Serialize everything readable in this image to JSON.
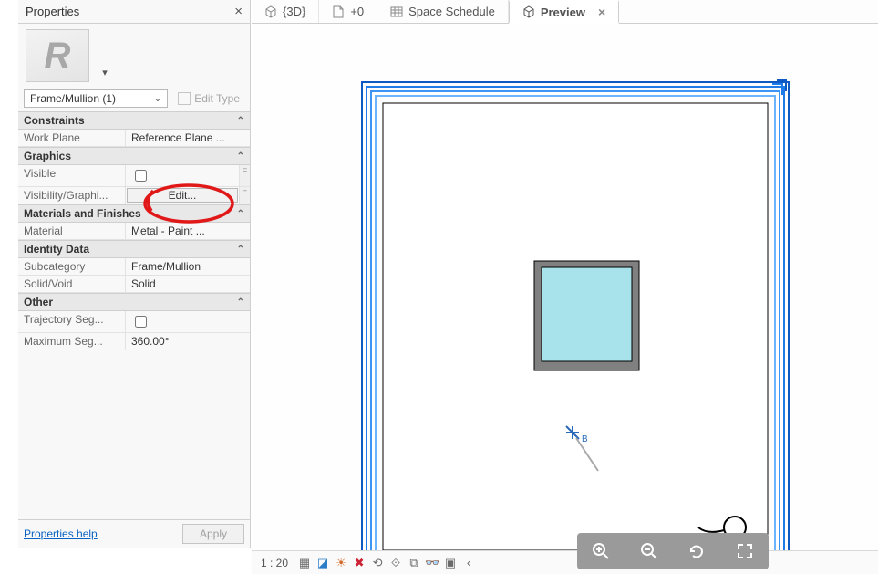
{
  "panel": {
    "title": "Properties",
    "type_selector": "Frame/Mullion (1)",
    "edit_type_label": "Edit Type",
    "groups": {
      "constraints": {
        "header": "Constraints",
        "work_plane": {
          "label": "Work Plane",
          "value": "Reference Plane ..."
        }
      },
      "graphics": {
        "header": "Graphics",
        "visible": {
          "label": "Visible"
        },
        "vis_overrides": {
          "label": "Visibility/Graphi...",
          "button": "Edit..."
        }
      },
      "materials": {
        "header": "Materials and Finishes",
        "material": {
          "label": "Material",
          "value": "Metal - Paint ..."
        }
      },
      "identity": {
        "header": "Identity Data",
        "subcategory": {
          "label": "Subcategory",
          "value": "Frame/Mullion"
        },
        "solid_void": {
          "label": "Solid/Void",
          "value": "Solid"
        }
      },
      "other": {
        "header": "Other",
        "trajectory": {
          "label": "Trajectory Seg..."
        },
        "max_seg": {
          "label": "Maximum Seg...",
          "value": "360.00°"
        }
      }
    },
    "help_link": "Properties help",
    "apply": "Apply"
  },
  "tabs": [
    {
      "label": "{3D}",
      "icon": "cube"
    },
    {
      "label": "+0",
      "icon": "doc"
    },
    {
      "label": "Space Schedule",
      "icon": "grid"
    },
    {
      "label": "Preview",
      "icon": "cube",
      "active": true,
      "closable": true
    }
  ],
  "status": {
    "scale": "1 : 20"
  }
}
